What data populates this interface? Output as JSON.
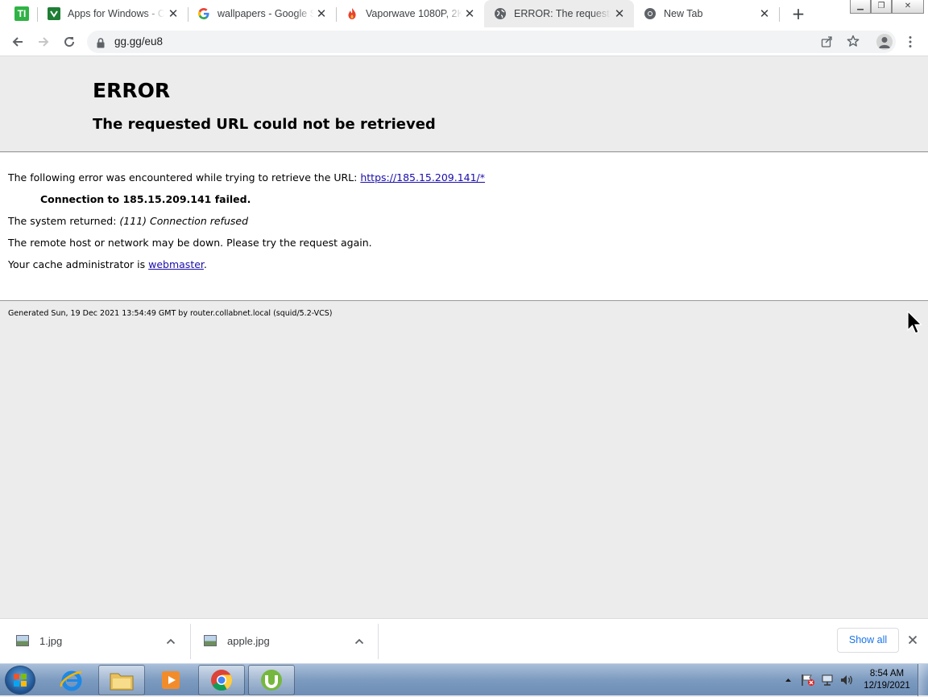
{
  "tabs": [
    {
      "title": "Apps for Windows - Ch",
      "favicon": "green-v-icon"
    },
    {
      "title": "wallpapers - Google Se",
      "favicon": "google-g-icon"
    },
    {
      "title": "Vaporwave 1080P, 2K,",
      "favicon": "flame-icon"
    },
    {
      "title": "ERROR: The requested",
      "favicon": "globe-icon"
    },
    {
      "title": "New Tab",
      "favicon": "chrome-icon"
    }
  ],
  "app_icon_label": "TI",
  "address_bar": {
    "url": "gg.gg/eu8"
  },
  "error_page": {
    "title": "ERROR",
    "subtitle": "The requested URL could not be retrieved",
    "intro": "The following error was encountered while trying to retrieve the URL: ",
    "url_link": "https://185.15.209.141/*",
    "failure": "Connection to 185.15.209.141 failed.",
    "system_prefix": "The system returned: ",
    "system_error": "(111) Connection refused",
    "advice": "The remote host or network may be down. Please try the request again.",
    "admin_prefix": "Your cache administrator is ",
    "admin_link": "webmaster",
    "admin_suffix": ".",
    "footer": "Generated Sun, 19 Dec 2021 13:54:49 GMT by router.collabnet.local (squid/5.2-VCS)"
  },
  "downloads": {
    "items": [
      {
        "name": "1.jpg"
      },
      {
        "name": "apple.jpg"
      }
    ],
    "show_all": "Show all"
  },
  "taskbar": {
    "apps": [
      "internet-explorer",
      "file-explorer",
      "media-player",
      "chrome",
      "utorrent"
    ],
    "clock_time": "8:54 AM",
    "clock_date": "12/19/2021"
  },
  "colors": {
    "link": "#1a0dab",
    "show_all": "#1a73e8",
    "page_bg": "#ececec"
  }
}
